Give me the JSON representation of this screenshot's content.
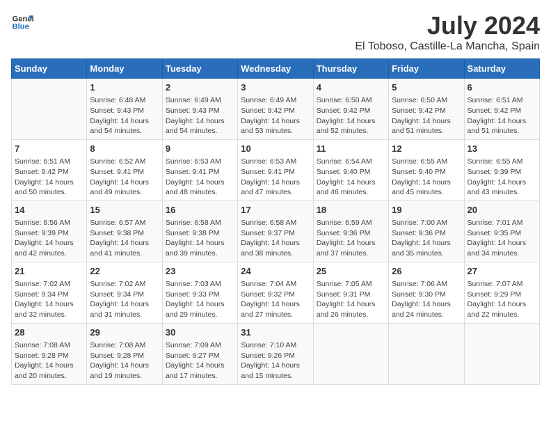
{
  "header": {
    "logo_general": "General",
    "logo_blue": "Blue",
    "title": "July 2024",
    "subtitle": "El Toboso, Castille-La Mancha, Spain"
  },
  "weekdays": [
    "Sunday",
    "Monday",
    "Tuesday",
    "Wednesday",
    "Thursday",
    "Friday",
    "Saturday"
  ],
  "weeks": [
    [
      {
        "day": "",
        "info": ""
      },
      {
        "day": "1",
        "info": "Sunrise: 6:48 AM\nSunset: 9:43 PM\nDaylight: 14 hours\nand 54 minutes."
      },
      {
        "day": "2",
        "info": "Sunrise: 6:49 AM\nSunset: 9:43 PM\nDaylight: 14 hours\nand 54 minutes."
      },
      {
        "day": "3",
        "info": "Sunrise: 6:49 AM\nSunset: 9:42 PM\nDaylight: 14 hours\nand 53 minutes."
      },
      {
        "day": "4",
        "info": "Sunrise: 6:50 AM\nSunset: 9:42 PM\nDaylight: 14 hours\nand 52 minutes."
      },
      {
        "day": "5",
        "info": "Sunrise: 6:50 AM\nSunset: 9:42 PM\nDaylight: 14 hours\nand 51 minutes."
      },
      {
        "day": "6",
        "info": "Sunrise: 6:51 AM\nSunset: 9:42 PM\nDaylight: 14 hours\nand 51 minutes."
      }
    ],
    [
      {
        "day": "7",
        "info": "Sunrise: 6:51 AM\nSunset: 9:42 PM\nDaylight: 14 hours\nand 50 minutes."
      },
      {
        "day": "8",
        "info": "Sunrise: 6:52 AM\nSunset: 9:41 PM\nDaylight: 14 hours\nand 49 minutes."
      },
      {
        "day": "9",
        "info": "Sunrise: 6:53 AM\nSunset: 9:41 PM\nDaylight: 14 hours\nand 48 minutes."
      },
      {
        "day": "10",
        "info": "Sunrise: 6:53 AM\nSunset: 9:41 PM\nDaylight: 14 hours\nand 47 minutes."
      },
      {
        "day": "11",
        "info": "Sunrise: 6:54 AM\nSunset: 9:40 PM\nDaylight: 14 hours\nand 46 minutes."
      },
      {
        "day": "12",
        "info": "Sunrise: 6:55 AM\nSunset: 9:40 PM\nDaylight: 14 hours\nand 45 minutes."
      },
      {
        "day": "13",
        "info": "Sunrise: 6:55 AM\nSunset: 9:39 PM\nDaylight: 14 hours\nand 43 minutes."
      }
    ],
    [
      {
        "day": "14",
        "info": "Sunrise: 6:56 AM\nSunset: 9:39 PM\nDaylight: 14 hours\nand 42 minutes."
      },
      {
        "day": "15",
        "info": "Sunrise: 6:57 AM\nSunset: 9:38 PM\nDaylight: 14 hours\nand 41 minutes."
      },
      {
        "day": "16",
        "info": "Sunrise: 6:58 AM\nSunset: 9:38 PM\nDaylight: 14 hours\nand 39 minutes."
      },
      {
        "day": "17",
        "info": "Sunrise: 6:58 AM\nSunset: 9:37 PM\nDaylight: 14 hours\nand 38 minutes."
      },
      {
        "day": "18",
        "info": "Sunrise: 6:59 AM\nSunset: 9:36 PM\nDaylight: 14 hours\nand 37 minutes."
      },
      {
        "day": "19",
        "info": "Sunrise: 7:00 AM\nSunset: 9:36 PM\nDaylight: 14 hours\nand 35 minutes."
      },
      {
        "day": "20",
        "info": "Sunrise: 7:01 AM\nSunset: 9:35 PM\nDaylight: 14 hours\nand 34 minutes."
      }
    ],
    [
      {
        "day": "21",
        "info": "Sunrise: 7:02 AM\nSunset: 9:34 PM\nDaylight: 14 hours\nand 32 minutes."
      },
      {
        "day": "22",
        "info": "Sunrise: 7:02 AM\nSunset: 9:34 PM\nDaylight: 14 hours\nand 31 minutes."
      },
      {
        "day": "23",
        "info": "Sunrise: 7:03 AM\nSunset: 9:33 PM\nDaylight: 14 hours\nand 29 minutes."
      },
      {
        "day": "24",
        "info": "Sunrise: 7:04 AM\nSunset: 9:32 PM\nDaylight: 14 hours\nand 27 minutes."
      },
      {
        "day": "25",
        "info": "Sunrise: 7:05 AM\nSunset: 9:31 PM\nDaylight: 14 hours\nand 26 minutes."
      },
      {
        "day": "26",
        "info": "Sunrise: 7:06 AM\nSunset: 9:30 PM\nDaylight: 14 hours\nand 24 minutes."
      },
      {
        "day": "27",
        "info": "Sunrise: 7:07 AM\nSunset: 9:29 PM\nDaylight: 14 hours\nand 22 minutes."
      }
    ],
    [
      {
        "day": "28",
        "info": "Sunrise: 7:08 AM\nSunset: 9:28 PM\nDaylight: 14 hours\nand 20 minutes."
      },
      {
        "day": "29",
        "info": "Sunrise: 7:08 AM\nSunset: 9:28 PM\nDaylight: 14 hours\nand 19 minutes."
      },
      {
        "day": "30",
        "info": "Sunrise: 7:09 AM\nSunset: 9:27 PM\nDaylight: 14 hours\nand 17 minutes."
      },
      {
        "day": "31",
        "info": "Sunrise: 7:10 AM\nSunset: 9:26 PM\nDaylight: 14 hours\nand 15 minutes."
      },
      {
        "day": "",
        "info": ""
      },
      {
        "day": "",
        "info": ""
      },
      {
        "day": "",
        "info": ""
      }
    ]
  ]
}
